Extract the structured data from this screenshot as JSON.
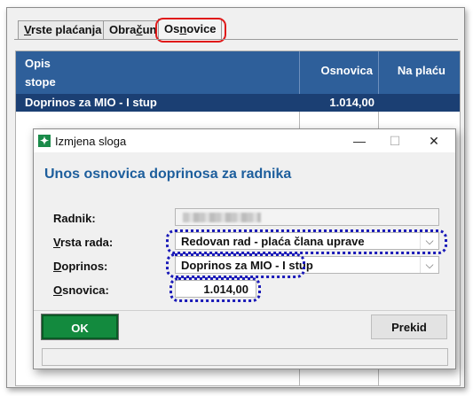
{
  "tabs": [
    {
      "pre": "",
      "accel": "V",
      "post": "rste plaćanja"
    },
    {
      "pre": "Obra",
      "accel": "č",
      "post": "un"
    },
    {
      "pre": "Os",
      "accel": "n",
      "post": "ovice"
    }
  ],
  "grid": {
    "headers": {
      "opis_line1": "Opis",
      "opis_line2": "stope",
      "osnovica": "Osnovica",
      "na_placu": "Na plaću"
    },
    "selected_row": {
      "opis": "Doprinos za MIO - I stup",
      "osnovica": "1.014,00",
      "na_placu": ""
    }
  },
  "dialog": {
    "title": "Izmjena sloga",
    "heading": "Unos osnovica doprinosa za radnika",
    "fields": {
      "radnik_label": "Radnik:",
      "vrsta_label_accel": "V",
      "vrsta_label_rest": "rsta rada:",
      "vrsta_value": "Redovan rad - plaća člana uprave",
      "doprinos_label_accel": "D",
      "doprinos_label_rest": "oprinos:",
      "doprinos_value": "Doprinos za MIO - I stup",
      "osnovica_label_accel": "O",
      "osnovica_label_rest": "snovica:",
      "osnovica_value": "1.014,00"
    },
    "buttons": {
      "ok": "OK",
      "cancel": "Prekid"
    },
    "window_controls": {
      "minimize": "—",
      "maximize": "☐",
      "close": "✕"
    },
    "icon": "app-logo-icon"
  },
  "colors": {
    "grid_header": "#2e5f9a",
    "selected_row": "#1b3f73",
    "ok_button": "#138a3e",
    "heading": "#1d5e9c",
    "tab_highlight": "#e01a1a",
    "dotted_highlight": "#1a1ab8"
  }
}
